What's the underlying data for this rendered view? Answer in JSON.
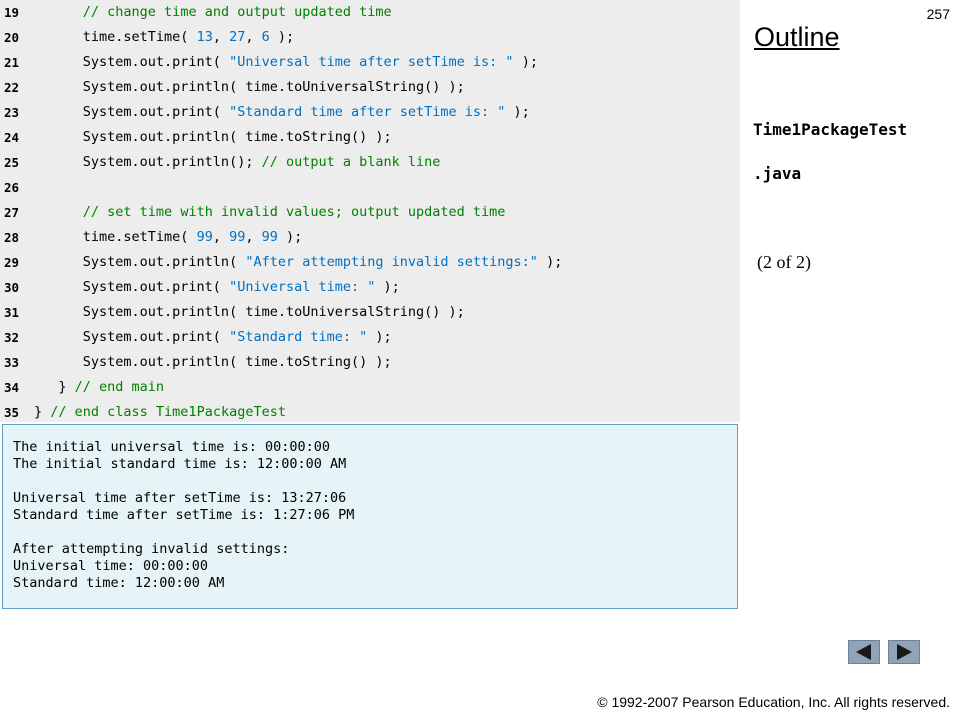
{
  "page_number": "257",
  "sidebar": {
    "outline_title": "Outline",
    "file_name_line1": "Time1PackageTest",
    "file_name_line2": ".java",
    "part_label": "(2 of 2)"
  },
  "code_lines": [
    {
      "no": "19",
      "segments": [
        {
          "t": "      ",
          "c": ""
        },
        {
          "t": "// change time and output updated time",
          "c": "cmt"
        }
      ]
    },
    {
      "no": "20",
      "segments": [
        {
          "t": "      time.setTime( ",
          "c": ""
        },
        {
          "t": "13",
          "c": "num"
        },
        {
          "t": ", ",
          "c": ""
        },
        {
          "t": "27",
          "c": "num"
        },
        {
          "t": ", ",
          "c": ""
        },
        {
          "t": "6",
          "c": "num"
        },
        {
          "t": " );",
          "c": ""
        }
      ]
    },
    {
      "no": "21",
      "segments": [
        {
          "t": "      System.out.print( ",
          "c": ""
        },
        {
          "t": "\"Universal time after setTime is: \"",
          "c": "str"
        },
        {
          "t": " );",
          "c": ""
        }
      ]
    },
    {
      "no": "22",
      "segments": [
        {
          "t": "      System.out.println( time.toUniversalString() );",
          "c": ""
        }
      ]
    },
    {
      "no": "23",
      "segments": [
        {
          "t": "      System.out.print( ",
          "c": ""
        },
        {
          "t": "\"Standard time after setTime is: \"",
          "c": "str"
        },
        {
          "t": " );",
          "c": ""
        }
      ]
    },
    {
      "no": "24",
      "segments": [
        {
          "t": "      System.out.println( time.toString() );",
          "c": ""
        }
      ]
    },
    {
      "no": "25",
      "segments": [
        {
          "t": "      System.out.println(); ",
          "c": ""
        },
        {
          "t": "// output a blank line",
          "c": "cmt"
        }
      ]
    },
    {
      "no": "26",
      "segments": [
        {
          "t": "",
          "c": ""
        }
      ]
    },
    {
      "no": "27",
      "segments": [
        {
          "t": "      ",
          "c": ""
        },
        {
          "t": "// set time with invalid values; output updated time",
          "c": "cmt"
        }
      ]
    },
    {
      "no": "28",
      "segments": [
        {
          "t": "      time.setTime( ",
          "c": ""
        },
        {
          "t": "99",
          "c": "num"
        },
        {
          "t": ", ",
          "c": ""
        },
        {
          "t": "99",
          "c": "num"
        },
        {
          "t": ", ",
          "c": ""
        },
        {
          "t": "99",
          "c": "num"
        },
        {
          "t": " );",
          "c": ""
        }
      ]
    },
    {
      "no": "29",
      "segments": [
        {
          "t": "      System.out.println( ",
          "c": ""
        },
        {
          "t": "\"After attempting invalid settings:\"",
          "c": "str"
        },
        {
          "t": " );",
          "c": ""
        }
      ]
    },
    {
      "no": "30",
      "segments": [
        {
          "t": "      System.out.print( ",
          "c": ""
        },
        {
          "t": "\"Universal time: \"",
          "c": "str"
        },
        {
          "t": " );",
          "c": ""
        }
      ]
    },
    {
      "no": "31",
      "segments": [
        {
          "t": "      System.out.println( time.toUniversalString() );",
          "c": ""
        }
      ]
    },
    {
      "no": "32",
      "segments": [
        {
          "t": "      System.out.print( ",
          "c": ""
        },
        {
          "t": "\"Standard time: \"",
          "c": "str"
        },
        {
          "t": " );",
          "c": ""
        }
      ]
    },
    {
      "no": "33",
      "segments": [
        {
          "t": "      System.out.println( time.toString() );",
          "c": ""
        }
      ]
    },
    {
      "no": "34",
      "segments": [
        {
          "t": "   } ",
          "c": ""
        },
        {
          "t": "// end main",
          "c": "cmt"
        }
      ]
    },
    {
      "no": "35",
      "segments": [
        {
          "t": "} ",
          "c": ""
        },
        {
          "t": "// end class Time1PackageTest",
          "c": "cmt"
        }
      ]
    }
  ],
  "output_lines": [
    "The initial universal time is: 00:00:00",
    "The initial standard time is: 12:00:00 AM",
    "",
    "Universal time after setTime is: 13:27:06",
    "Standard time after setTime is: 1:27:06 PM",
    "",
    "After attempting invalid settings:",
    "Universal time: 00:00:00",
    "Standard time: 12:00:00 AM"
  ],
  "navigation": {
    "prev_icon": "left-triangle-icon",
    "next_icon": "right-triangle-icon",
    "button_color": "#8fa4b8"
  },
  "footer": {
    "copyright_symbol": "©",
    "copyright_text": " 1992-2007 Pearson Education, Inc.  All rights reserved."
  }
}
